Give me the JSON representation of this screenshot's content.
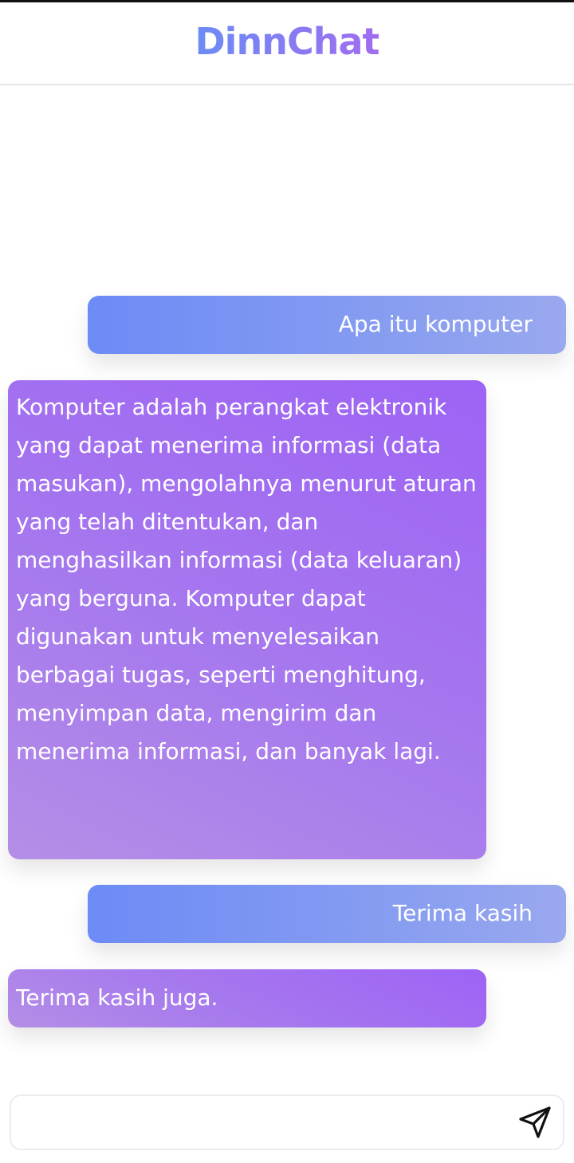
{
  "app": {
    "title": "DinnChat"
  },
  "messages": [
    {
      "role": "user",
      "text": "Apa itu komputer"
    },
    {
      "role": "bot",
      "text": "Komputer adalah perangkat elektronik yang dapat menerima informasi (data masukan), mengolahnya menurut aturan yang telah ditentukan, dan menghasilkan informasi (data keluaran) yang berguna. Komputer dapat digunakan untuk menyelesaikan berbagai tugas, seperti menghitung, menyimpan data, mengirim dan menerima informasi, dan banyak lagi."
    },
    {
      "role": "user",
      "text": "Terima kasih"
    },
    {
      "role": "bot",
      "text": "Terima kasih juga."
    }
  ],
  "composer": {
    "value": "",
    "placeholder": "",
    "send_icon": "send-icon"
  },
  "colors": {
    "user_bubble_start": "#6d8bf6",
    "user_bubble_end": "#9aa8ee",
    "bot_bubble_start": "#b48ee6",
    "bot_bubble_end": "#9d63f5",
    "title_start": "#6b8cf5",
    "title_end": "#a06cf0"
  }
}
